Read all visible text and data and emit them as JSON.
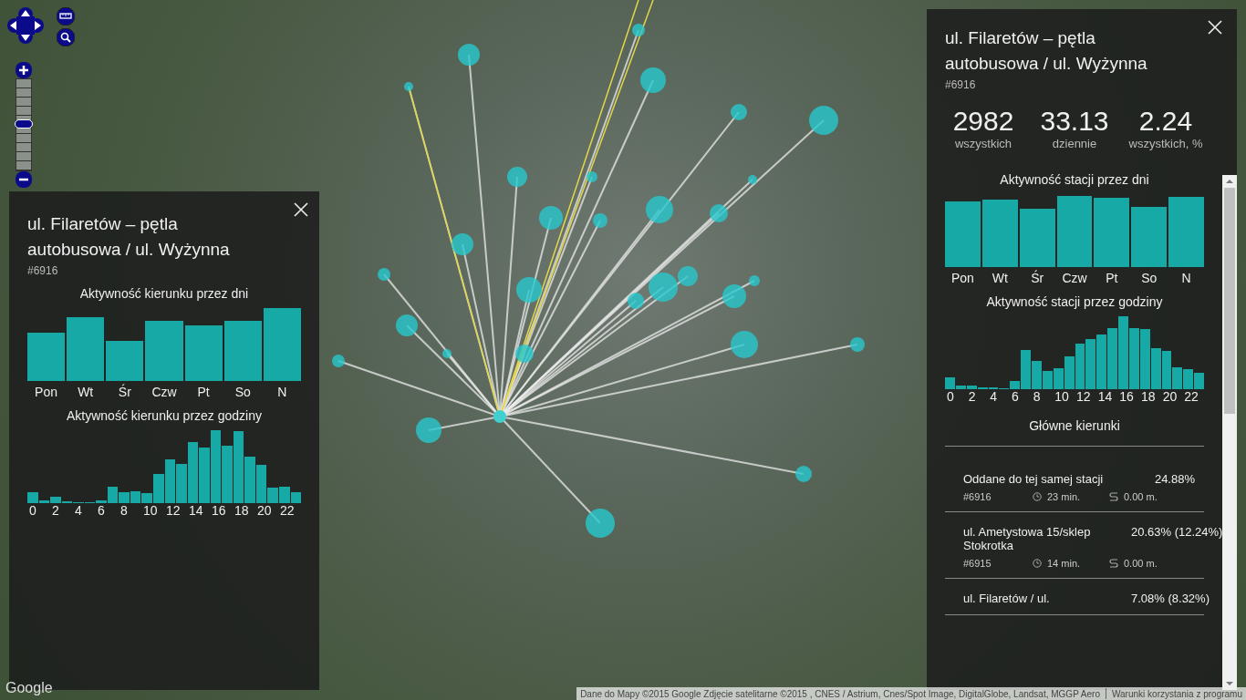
{
  "map": {
    "attribution": "Dane do Mapy ©2015 Google Zdjęcie satelitarne ©2015 , CNES / Astrium, Cnes/Spot Image, DigitalGlobe, Landsat, MGGP Aero",
    "terms_link": "Warunki korzystania z programu",
    "logo": "Google",
    "zoom": {
      "level": 0.5
    }
  },
  "direction_panel": {
    "title": "ul. Filaretów – pętla autobusowa / ul. Wyżynna",
    "id": "#6916",
    "days_title": "Aktywność kierunku przez dni",
    "days": [
      "Pon",
      "Wt",
      "Śr",
      "Czw",
      "Pt",
      "So",
      "N"
    ],
    "hours_title": "Aktywność kierunku przez godziny",
    "hour_labels": [
      "0",
      "2",
      "4",
      "6",
      "8",
      "10",
      "12",
      "14",
      "16",
      "18",
      "20",
      "22"
    ]
  },
  "station_panel": {
    "title": "ul. Filaretów – pętla autobusowa / ul. Wyżynna",
    "id": "#6916",
    "stats": [
      {
        "value": "2982",
        "label": "wszystkich"
      },
      {
        "value": "33.13",
        "label": "dziennie"
      },
      {
        "value": "2.24",
        "label": "wszystkich, %"
      }
    ],
    "days_title": "Aktywność stacji przez dni",
    "days": [
      "Pon",
      "Wt",
      "Śr",
      "Czw",
      "Pt",
      "So",
      "N"
    ],
    "hours_title": "Aktywność stacji przez godziny",
    "hour_labels": [
      "0",
      "2",
      "4",
      "6",
      "8",
      "10",
      "12",
      "14",
      "16",
      "18",
      "20",
      "22"
    ],
    "directions_title": "Główne kierunki",
    "directions": [
      {
        "name": "Oddane do tej samej stacji",
        "share": "24.88%",
        "id": "#6916",
        "time": "23 min.",
        "distance": "0.00 m."
      },
      {
        "name": "ul. Ametystowa 15/sklep Stokrotka",
        "share": "20.63% (12.24%)",
        "id": "#6915",
        "time": "14 min.",
        "distance": "0.00 m."
      },
      {
        "name": "ul. Filaretów / ul.",
        "share": "7.08% (8.32%)"
      }
    ]
  }
}
